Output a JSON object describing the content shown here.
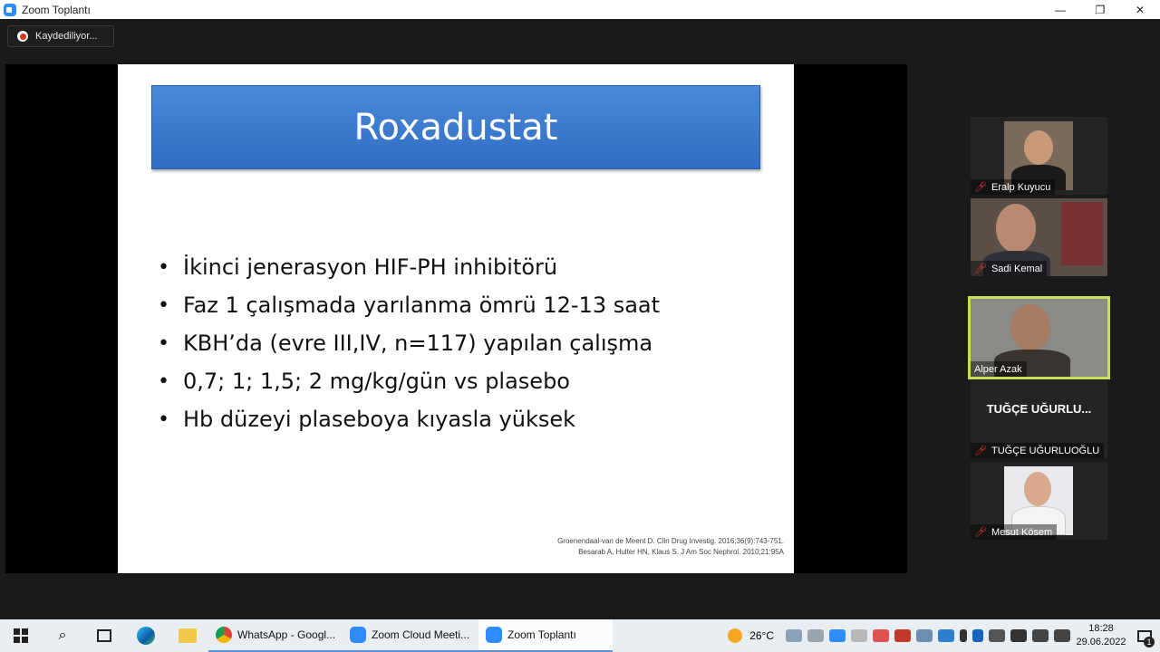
{
  "window": {
    "title": "Zoom Toplantı",
    "minimize": "—",
    "restore": "❐",
    "close": "✕"
  },
  "recording": {
    "label": "Kaydediliyor..."
  },
  "slide": {
    "title": "Roxadustat",
    "bullet_char": "•",
    "bullets": [
      "İkinci jenerasyon HIF-PH inhibitörü",
      "Faz 1 çalışmada yarılanma ömrü 12-13 saat",
      "KBH’da (evre III,IV, n=117) yapılan çalışma",
      "0,7; 1; 1,5; 2 mg/kg/gün vs plasebo",
      "Hb düzeyi plaseboya kıyasla yüksek"
    ],
    "references": [
      "Groenendaal-van de Meent D. Clin Drug Investig. 2016;36(9):743-751.",
      "Besarab A, Hulter HN, Klaus S. J Am Soc Nephrol. 2010;21:95A"
    ]
  },
  "participants": [
    {
      "name": "Eralp Kuyucu",
      "muted": true
    },
    {
      "name": "Sadi Kemal",
      "muted": true
    },
    {
      "name": "Alper Azak",
      "muted": false,
      "active_speaker": true
    },
    {
      "name": "TUĞÇE UĞURLUOĞLU",
      "display_short": "TUĞÇE UĞURLU...",
      "muted": true
    },
    {
      "name": "Mesut Kösem",
      "muted": true
    }
  ],
  "taskbar": {
    "apps": [
      {
        "label": "WhatsApp - Googl...",
        "icon": "chrome-icon"
      },
      {
        "label": "Zoom Cloud Meeti...",
        "icon": "zoom-icon"
      },
      {
        "label": "Zoom Toplantı",
        "icon": "zoom-icon",
        "active": true
      }
    ],
    "weather": "26°C",
    "time": "18:28",
    "date": "29.06.2022",
    "notification_count": "1"
  },
  "colors": {
    "accent_green": "#c6e05a",
    "slide_header_blue": "#3a78cc",
    "zoom_blue": "#2d8cff"
  }
}
